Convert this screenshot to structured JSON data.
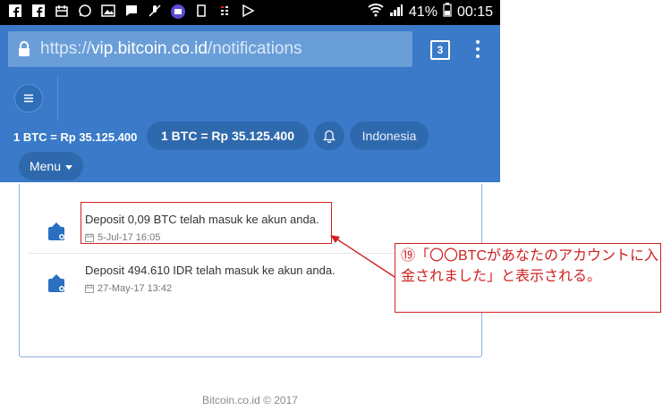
{
  "status_bar": {
    "battery": "41%",
    "time": "00:15"
  },
  "browser": {
    "url_scheme": "https://",
    "url_host": "vip.bitcoin.co.id",
    "url_path": "/notifications",
    "tab_count": "3"
  },
  "navbar": {
    "rate_text": "1 BTC = Rp 35.125.400",
    "rate_pill": "1 BTC = Rp 35.125.400",
    "language": "Indonesia",
    "menu_label": "Menu"
  },
  "notifications": [
    {
      "title": "Deposit 0,09 BTC telah masuk ke akun anda.",
      "date": "5-Jul-17 16:05"
    },
    {
      "title": "Deposit 494.610 IDR telah masuk ke akun anda.",
      "date": "27-May-17 13:42"
    }
  ],
  "footer": "Bitcoin.co.id © 2017",
  "annotation": "⑲「〇〇BTCがあなたのアカウントに入金されました」と表示される。",
  "colors": {
    "header_blue": "#3a7ac8",
    "pill_blue": "#2f69ad",
    "annotation_red": "#d02020",
    "icon_blue": "#2a6fc0"
  }
}
